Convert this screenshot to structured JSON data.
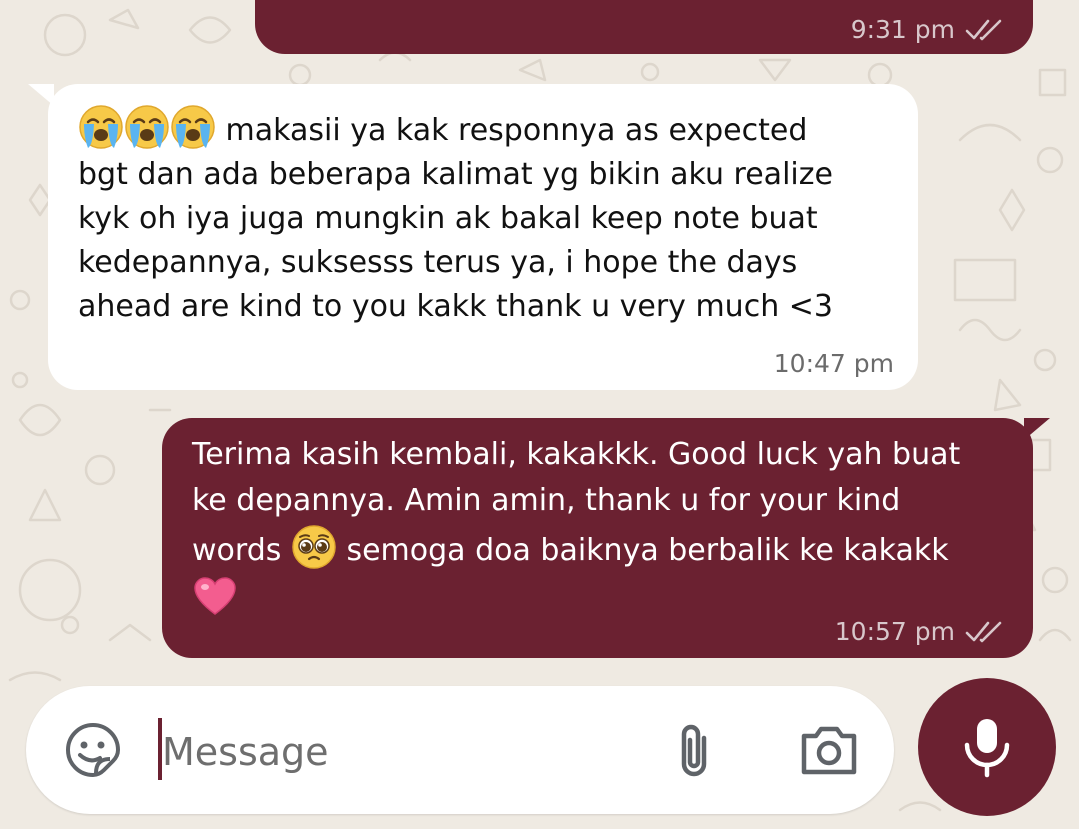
{
  "conversation": {
    "messages": [
      {
        "direction": "outgoing",
        "time": "9:31 pm",
        "status_icon": "double-check-icon"
      },
      {
        "direction": "incoming",
        "lines": [
          "makasii ya kak responnya as expected",
          "bgt dan ada beberapa kalimat yg bikin aku realize",
          "kyk oh iya juga mungkin ak bakal keep note buat",
          "kedepannya, suksesss terus ya, i hope the days",
          "ahead are kind to you kakk thank u very much <3"
        ],
        "emojis": [
          "loudly-crying-face-emoji",
          "loudly-crying-face-emoji",
          "loudly-crying-face-emoji"
        ],
        "time": "10:47 pm"
      },
      {
        "direction": "outgoing",
        "lines": [
          "Terima kasih kembali, kakakkk. Good luck yah buat",
          "ke depannya. Amin amin, thank u for your kind",
          "words",
          "semoga doa baiknya berbalik ke kakakk"
        ],
        "emojis": [
          "pleading-face-emoji",
          "pink-heart-emoji"
        ],
        "time": "10:57 pm",
        "status_icon": "double-check-icon"
      }
    ]
  },
  "composer": {
    "placeholder": "Message",
    "icons": {
      "sticker": "sticker-icon",
      "attach": "paperclip-icon",
      "camera": "camera-icon",
      "mic": "microphone-icon"
    }
  },
  "colors": {
    "wallpaper": "#efeae2",
    "outgoing_bubble": "#6b2131",
    "incoming_bubble": "#ffffff",
    "accent": "#6b2131"
  }
}
